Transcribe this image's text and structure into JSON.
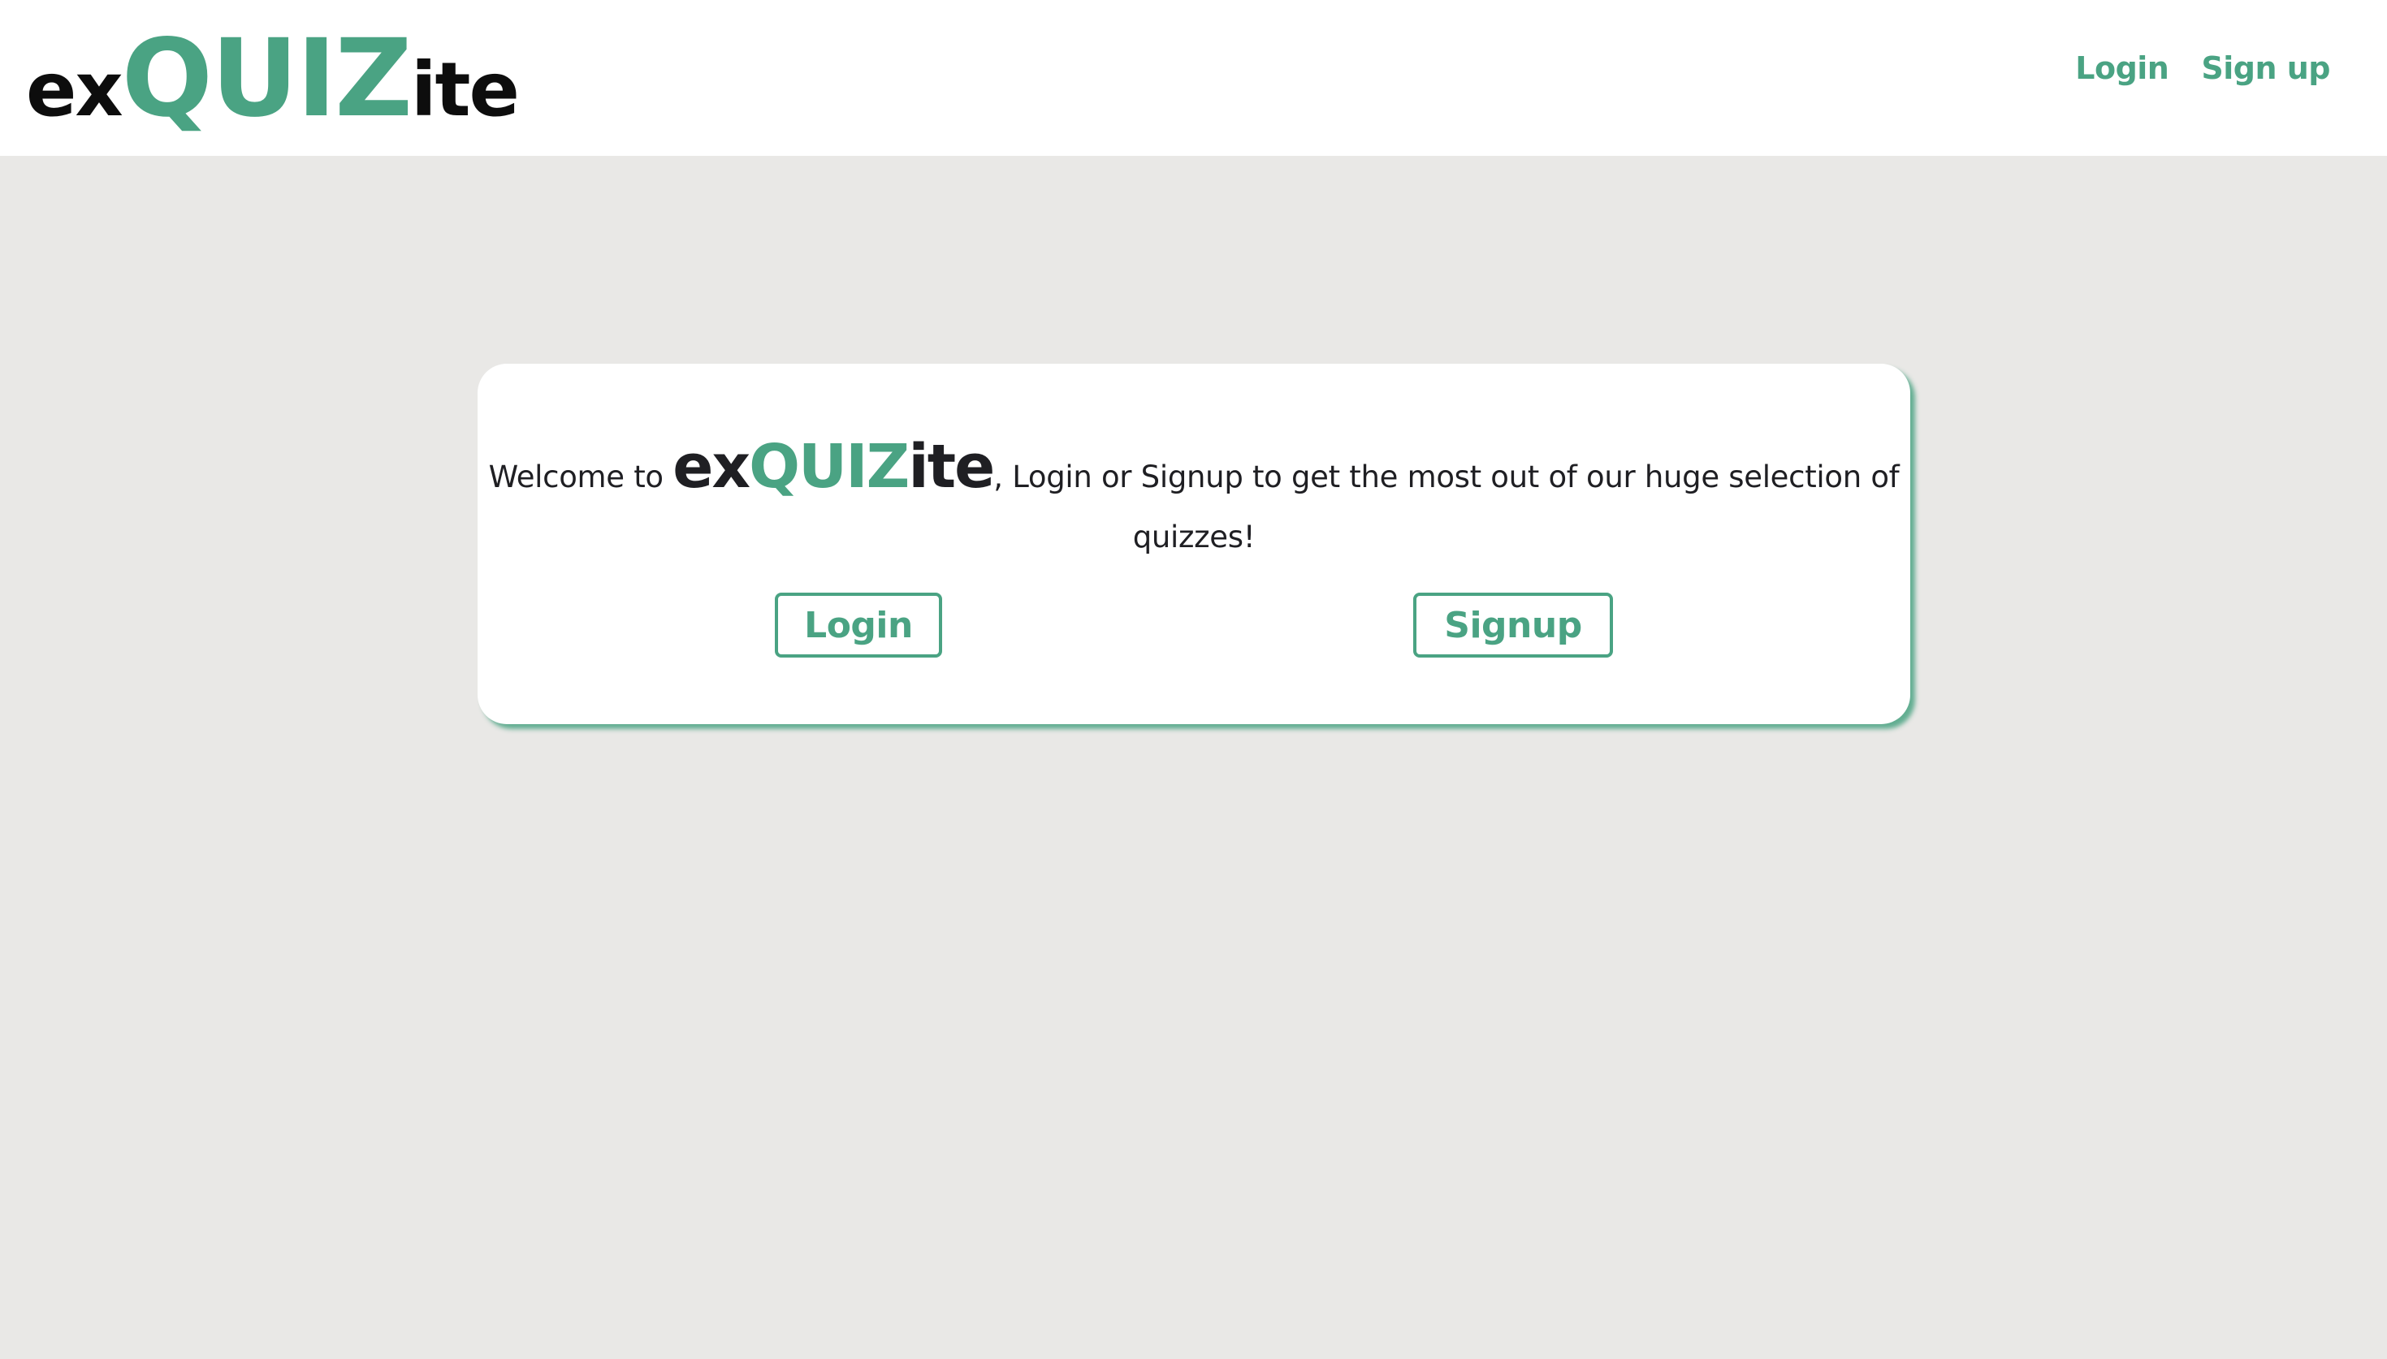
{
  "header": {
    "logo": {
      "prefix": "ex",
      "highlight": "QUIZ",
      "suffix": "ite"
    },
    "nav": {
      "login_label": "Login",
      "signup_label": "Sign up"
    }
  },
  "card": {
    "welcome_prefix": "Welcome to ",
    "brand": {
      "prefix": "ex",
      "highlight": "QUIZ",
      "suffix": "ite"
    },
    "welcome_suffix": ", Login or Signup to get the most out of our huge selection of quizzes!",
    "login_button": "Login",
    "signup_button": "Signup"
  },
  "colors": {
    "accent": "#4aa383",
    "background": "#e9e8e6",
    "text": "#1f1f23"
  }
}
